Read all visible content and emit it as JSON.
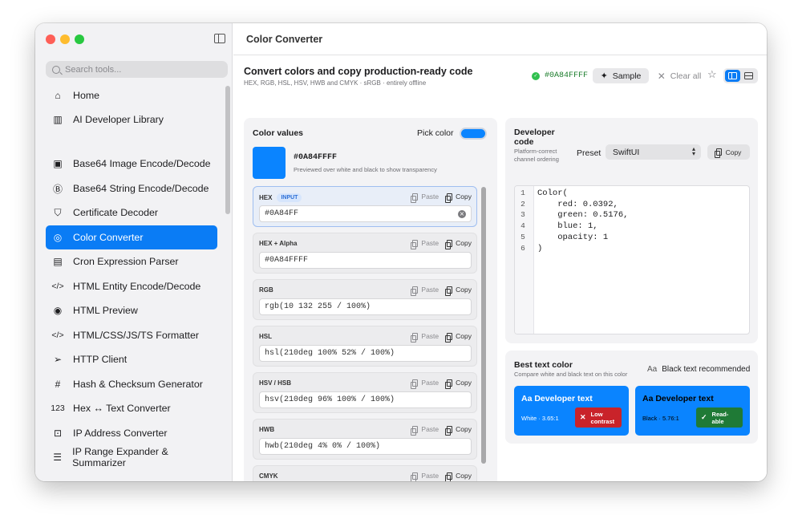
{
  "app": {
    "title": "Color Converter"
  },
  "sidebar": {
    "search_placeholder": "Search tools...",
    "items": [
      {
        "label": "Home",
        "icon": "house-icon",
        "glyph": "⌂"
      },
      {
        "label": "AI Developer Library",
        "icon": "books-icon",
        "glyph": "▥"
      },
      {
        "label": "Base64 Image Encode/Decode",
        "icon": "image-icon",
        "glyph": "▣"
      },
      {
        "label": "Base64 String Encode/Decode",
        "icon": "letter-b-icon",
        "glyph": "Ⓑ"
      },
      {
        "label": "Certificate Decoder",
        "icon": "shield-check-icon",
        "glyph": "⛉"
      },
      {
        "label": "Color Converter",
        "icon": "palette-icon",
        "glyph": "◎",
        "active": true
      },
      {
        "label": "Cron Expression Parser",
        "icon": "calendar-clock-icon",
        "glyph": "▤"
      },
      {
        "label": "HTML Entity Encode/Decode",
        "icon": "code-brackets-icon",
        "glyph": "</>"
      },
      {
        "label": "HTML Preview",
        "icon": "eye-icon",
        "glyph": "◉"
      },
      {
        "label": "HTML/CSS/JS/TS Formatter",
        "icon": "code-brackets-icon",
        "glyph": "</>"
      },
      {
        "label": "HTTP Client",
        "icon": "paper-plane-icon",
        "glyph": "➢"
      },
      {
        "label": "Hash & Checksum Generator",
        "icon": "hash-icon",
        "glyph": "#"
      },
      {
        "label": "Hex ↔ Text Converter",
        "icon": "numbers-icon",
        "glyph": "123"
      },
      {
        "label": "IP Address Converter",
        "icon": "network-icon",
        "glyph": "⊡"
      },
      {
        "label": "IP Range Expander & Summarizer",
        "icon": "list-icon",
        "glyph": "☰"
      }
    ]
  },
  "header": {
    "title": "Convert colors and copy production-ready code",
    "subtitle": "HEX, RGB, HSL, HSV, HWB and CMYK · sRGB · entirely offline",
    "current_hex": "#0A84FFFF",
    "sample_label": "Sample",
    "clear_label": "Clear all"
  },
  "color_values": {
    "title": "Color values",
    "pick_label": "Pick color",
    "swatch_hex": "#0A84FFFF",
    "swatch_note": "Previewed over white and black to show transparency",
    "paste_label": "Paste",
    "copy_label": "Copy",
    "fields": [
      {
        "label": "HEX",
        "badge": "INPUT",
        "value": "#0A84FF"
      },
      {
        "label": "HEX + Alpha",
        "value": "#0A84FFFF"
      },
      {
        "label": "RGB",
        "value": "rgb(10 132 255 / 100%)"
      },
      {
        "label": "HSL",
        "value": "hsl(210deg 100% 52% / 100%)"
      },
      {
        "label": "HSV / HSB",
        "value": "hsv(210deg 96% 100% / 100%)"
      },
      {
        "label": "HWB",
        "value": "hwb(210deg 4% 0% / 100%)"
      },
      {
        "label": "CMYK",
        "value": ""
      }
    ]
  },
  "developer_code": {
    "title_line1": "Developer",
    "title_line2": "code",
    "subtitle": "Platform-correct channel ordering",
    "preset_label": "Preset",
    "preset_value": "SwiftUI",
    "copy_label": "Copy",
    "lines": [
      "Color(",
      "    red: 0.0392,",
      "    green: 0.5176,",
      "    blue: 1,",
      "    opacity: 1",
      ")"
    ]
  },
  "best_text": {
    "title": "Best text color",
    "subtitle": "Compare white and black text on this color",
    "recommendation_aa": "Aa",
    "recommendation": "Black text recommended",
    "sample_text": "Aa Developer text",
    "white_ratio": "White · 3.65:1",
    "white_badge_line1": "Low",
    "white_badge_line2": "contrast",
    "black_ratio": "Black · 5.76:1",
    "black_badge_line1": "Read-",
    "black_badge_line2": "able"
  },
  "colors": {
    "accent": "#0A7CF5",
    "current_color": "#0A84FF",
    "success": "#1F7A36",
    "danger": "#C9232A"
  }
}
